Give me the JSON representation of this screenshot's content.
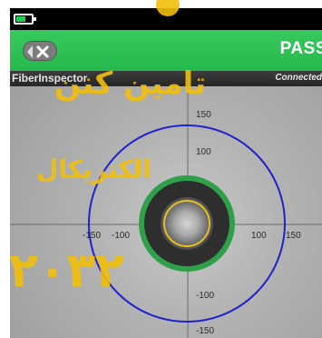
{
  "status_bar": {
    "battery_icon": "battery-icon",
    "battery_level": 0.6
  },
  "title_bar": {
    "back_icon": "back-x-icon",
    "result": "PASS"
  },
  "info_bar": {
    "app_name": "FiberInspector",
    "connection": "Connected"
  },
  "fiber_view": {
    "x_ticks": [
      "-150",
      "-100",
      "100",
      "150"
    ],
    "y_ticks": [
      "150",
      "100",
      "-100",
      "-150"
    ]
  },
  "watermark": {
    "line1": "تامین کنن",
    "line2": "الکتریکال",
    "line3": "۲۰۳۲"
  },
  "colors": {
    "pass_green": "#2fc457",
    "zone_blue": "#2222cc",
    "zone_yellow": "#e8c020",
    "zone_green": "#2fa04a"
  }
}
